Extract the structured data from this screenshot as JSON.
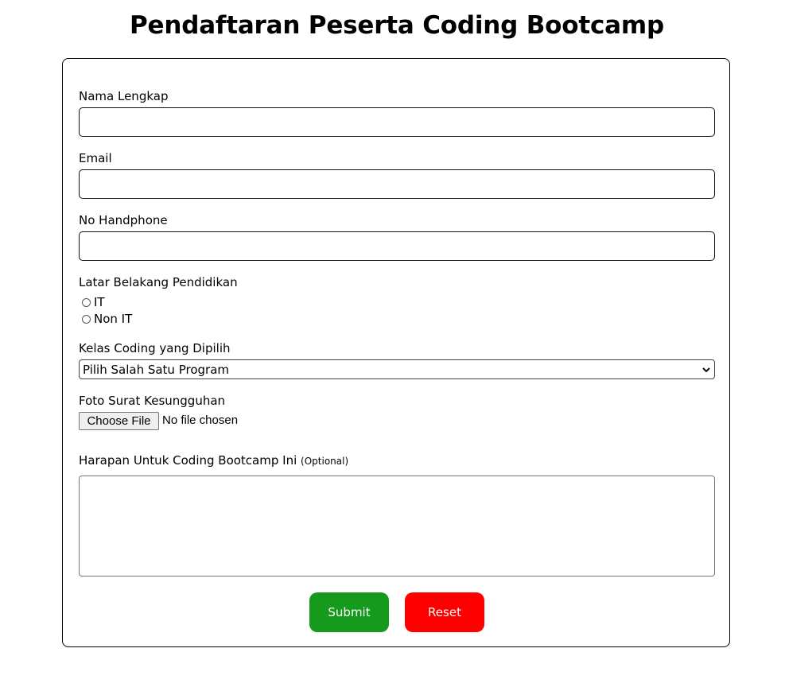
{
  "page": {
    "title": "Pendaftaran Peserta Coding Bootcamp"
  },
  "form": {
    "name_label": "Nama Lengkap",
    "name_value": "",
    "email_label": "Email",
    "email_value": "",
    "phone_label": "No Handphone",
    "phone_value": "",
    "education_label": "Latar Belakang Pendidikan",
    "education_options": [
      "IT",
      "Non IT"
    ],
    "education_selected": null,
    "class_label": "Kelas Coding yang Dipilih",
    "class_selected": "Pilih Salah Satu Program",
    "file_label": "Foto Surat Kesungguhan",
    "file_button": "Choose File",
    "file_status": "No file chosen",
    "hope_label": "Harapan Untuk Coding Bootcamp Ini",
    "hope_optional": "(Optional)",
    "hope_value": "",
    "submit_label": "Submit",
    "reset_label": "Reset"
  },
  "colors": {
    "submit": "#159a1c",
    "reset": "#ff0000"
  },
  "icons": {
    "select_arrow": "chevron-down-icon"
  }
}
